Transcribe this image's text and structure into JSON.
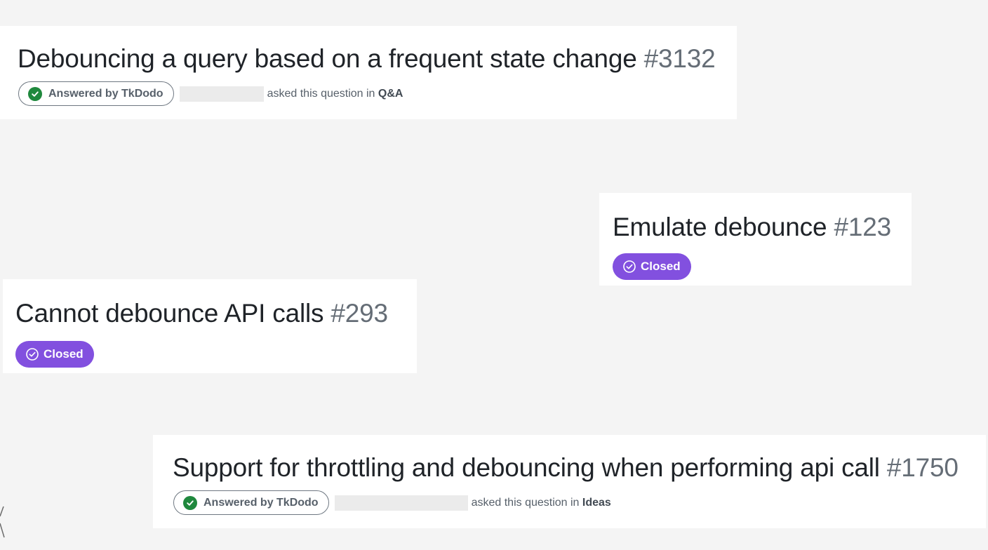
{
  "discussions": [
    {
      "title": "Debouncing a query based on a frequent state change",
      "number": "#3132",
      "badge": "Answered by TkDodo",
      "asked_text": "asked this question in",
      "category": "Q&A"
    },
    {
      "title": "Emulate debounce",
      "number": "#123",
      "status": "Closed"
    },
    {
      "title": "Cannot debounce API calls",
      "number": "#293",
      "status": "Closed"
    },
    {
      "title": "Support for throttling and debouncing when performing api call",
      "number": "#1750",
      "badge": "Answered by TkDodo",
      "asked_text": "asked this question in",
      "category": "Ideas"
    }
  ],
  "colors": {
    "background": "#f4f4f4",
    "card": "#ffffff",
    "answered_check": "#1f883d",
    "closed_badge": "#8250df",
    "number_text": "#656d76"
  },
  "icons": {
    "answered": "check-circle-fill-icon",
    "closed": "check-circle-outline-icon"
  }
}
